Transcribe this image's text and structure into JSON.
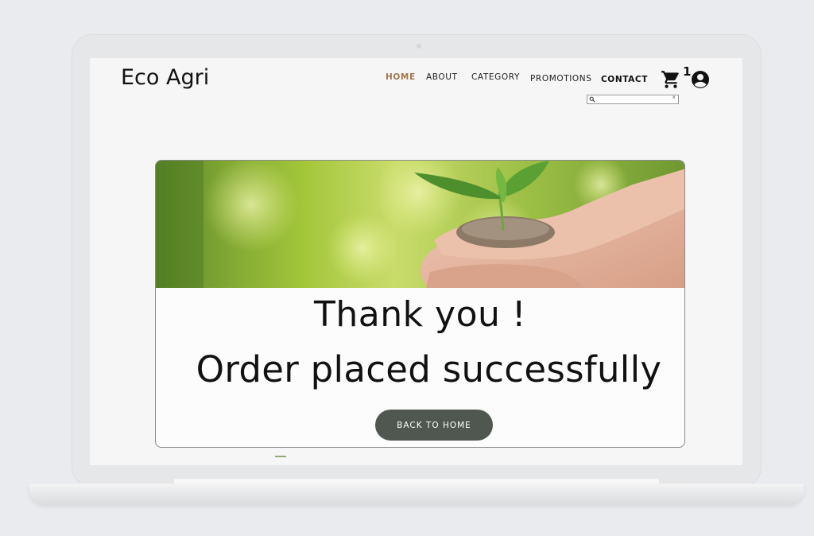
{
  "site": {
    "brand": "Eco Agri"
  },
  "nav": {
    "items": [
      {
        "label": "HOME",
        "active": true
      },
      {
        "label": "ABOUT",
        "active": false
      },
      {
        "label": "CATEGORY",
        "active": false
      },
      {
        "label": "PROMOTIONS",
        "active": false
      },
      {
        "label": "CONTACT",
        "active": false
      }
    ],
    "cart_icon": "shopping-cart-icon",
    "cart_count": "1",
    "account_icon": "account-circle-icon"
  },
  "search": {
    "icon": "search-icon",
    "value": "",
    "clear_label": "×"
  },
  "confirmation": {
    "image": "seedling-in-hands",
    "title": "Thank you !",
    "message": "Order placed successfully",
    "back_button_label": "BACK TO HOME"
  },
  "colors": {
    "accent": "#a4774f",
    "button": "#4f5750",
    "screen_bg": "#f6f6f6"
  }
}
